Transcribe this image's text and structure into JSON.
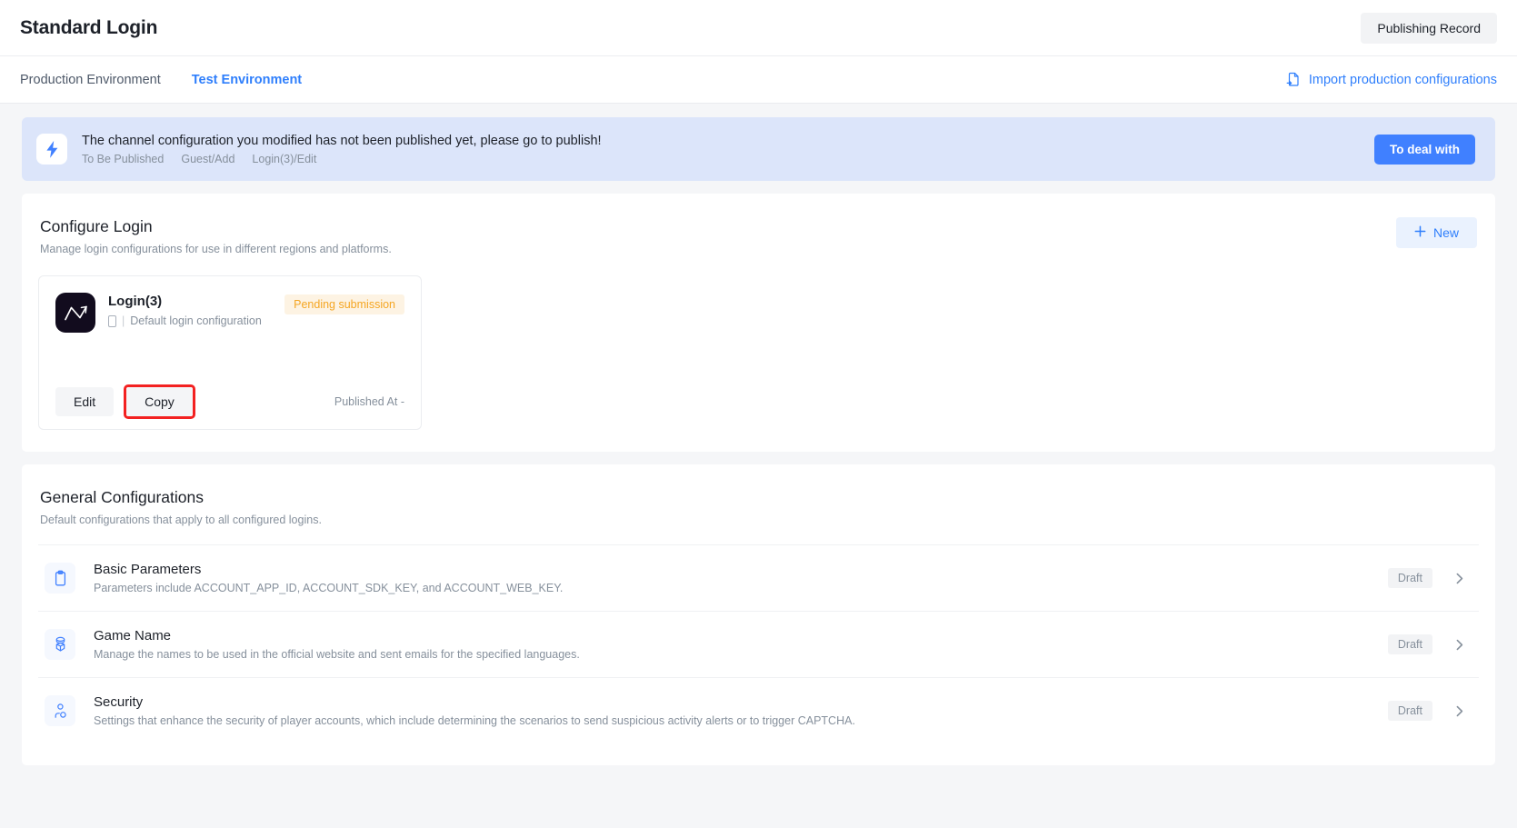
{
  "header": {
    "title": "Standard Login",
    "publishing_record_label": "Publishing Record"
  },
  "tabs": {
    "items": [
      {
        "label": "Production Environment",
        "active": false
      },
      {
        "label": "Test Environment",
        "active": true
      }
    ],
    "import_link_label": "Import production configurations",
    "import_icon": "import-document-icon"
  },
  "alert": {
    "icon": "lightning-bolt-icon",
    "message": "The channel configuration you modified has not been published yet, please go to publish!",
    "meta": [
      "To Be Published",
      "Guest/Add",
      "Login(3)/Edit"
    ],
    "action_label": "To deal with"
  },
  "configure_login": {
    "title": "Configure Login",
    "subtitle": "Manage login configurations for use in different regions and platforms.",
    "new_button_label": "New",
    "new_button_icon": "plus-icon",
    "card": {
      "app_icon": "app-logo-zigzag-icon",
      "name": "Login(3)",
      "platform_icon": "mobile-device-icon",
      "separator": "|",
      "description": "Default login configuration",
      "status": "Pending submission",
      "edit_label": "Edit",
      "copy_label": "Copy",
      "published_at": "Published At -"
    }
  },
  "general_configurations": {
    "title": "General Configurations",
    "subtitle": "Default configurations that apply to all configured logins.",
    "rows": [
      {
        "icon": "clipboard-icon",
        "title": "Basic Parameters",
        "description": "Parameters include ACCOUNT_APP_ID, ACCOUNT_SDK_KEY, and ACCOUNT_WEB_KEY.",
        "status": "Draft",
        "chevron": "chevron-right-icon"
      },
      {
        "icon": "cube-stack-icon",
        "title": "Game Name",
        "description": "Manage the names to be used in the official website and sent emails for the specified languages.",
        "status": "Draft",
        "chevron": "chevron-right-icon"
      },
      {
        "icon": "user-security-icon",
        "title": "Security",
        "description": "Settings that enhance the security of player accounts, which include determining the scenarios to send suspicious activity alerts or to trigger CAPTCHA.",
        "status": "Draft",
        "chevron": "chevron-right-icon"
      }
    ]
  },
  "colors": {
    "accent": "#2f7ffc",
    "primary_button": "#4080ff",
    "alert_bg": "#dce5fa",
    "pending_text": "#f5a623",
    "pending_bg": "#fdf3e3",
    "highlight_outline": "#f32121"
  }
}
